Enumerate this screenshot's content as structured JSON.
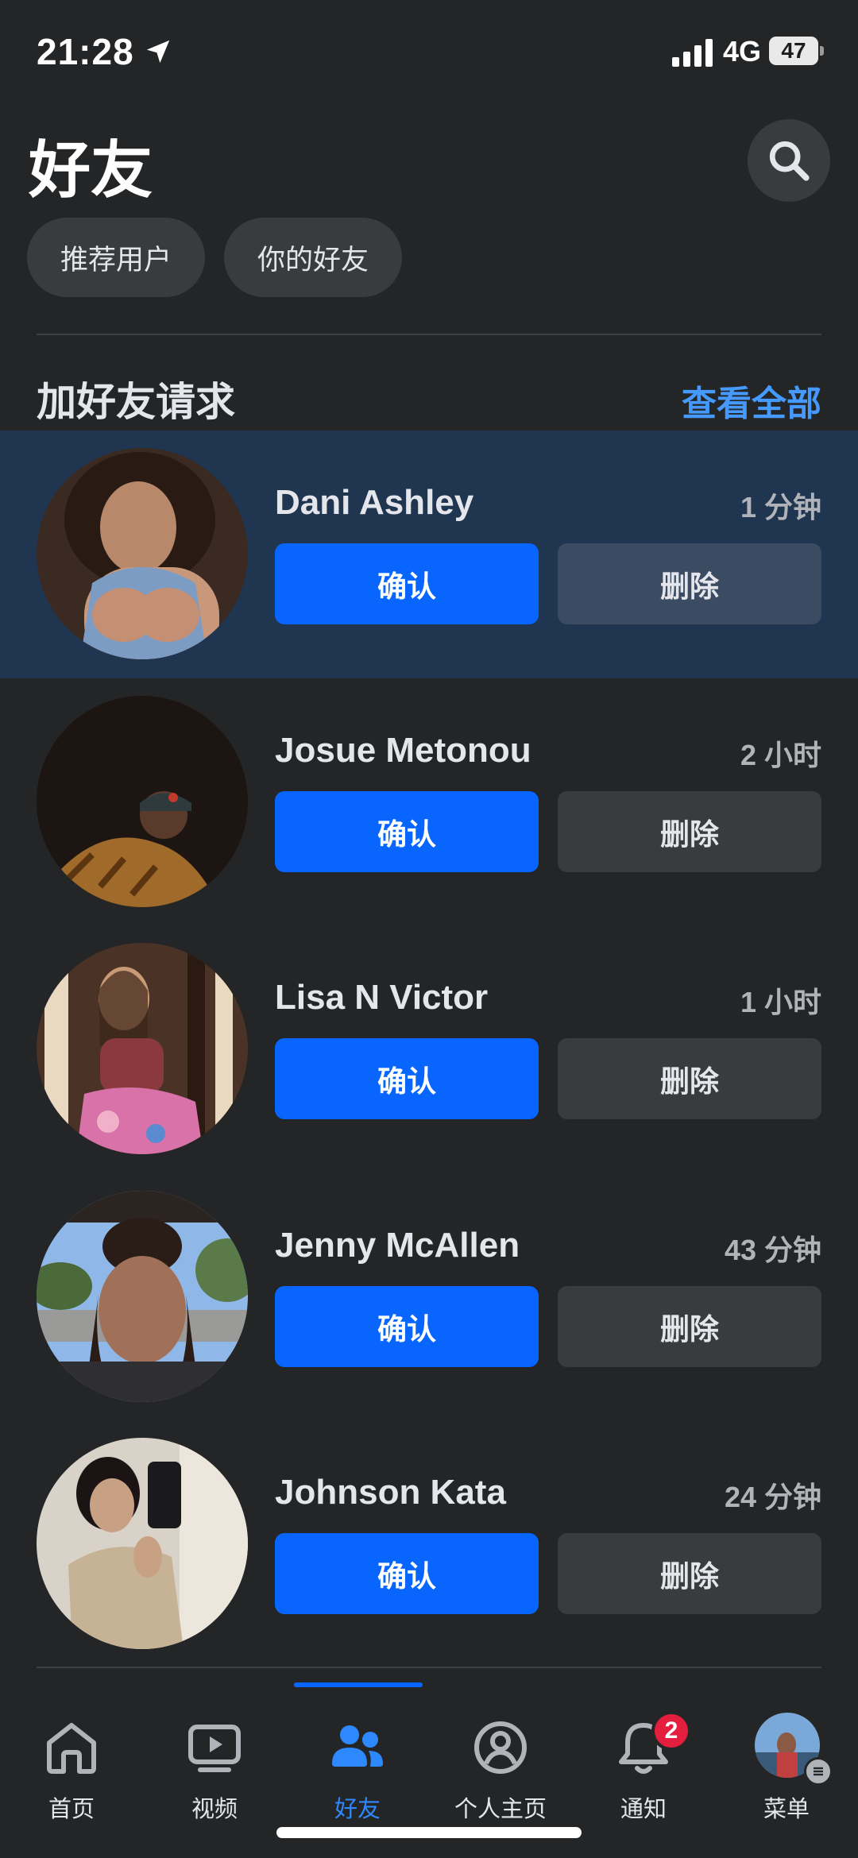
{
  "status_bar": {
    "time": "21:28",
    "network": "4G",
    "battery": "47"
  },
  "header": {
    "title": "好友",
    "chips": {
      "suggestions": "推荐用户",
      "your_friends": "你的好友"
    }
  },
  "requests_section": {
    "title": "加好友请求",
    "see_all": "查看全部",
    "items": [
      {
        "name": "Dani Ashley",
        "time": "1 分钟",
        "confirm": "确认",
        "delete": "删除"
      },
      {
        "name": "Josue Metonou",
        "time": "2 小时",
        "confirm": "确认",
        "delete": "删除"
      },
      {
        "name": "Lisa N Victor",
        "time": "1 小时",
        "confirm": "确认",
        "delete": "删除"
      },
      {
        "name": "Jenny McAllen",
        "time": "43 分钟",
        "confirm": "确认",
        "delete": "删除"
      },
      {
        "name": "Johnson Kata",
        "time": "24 分钟",
        "confirm": "确认",
        "delete": "删除"
      }
    ]
  },
  "tab_bar": {
    "tabs": [
      {
        "label": "首页",
        "icon": "home-icon"
      },
      {
        "label": "视频",
        "icon": "video-icon"
      },
      {
        "label": "好友",
        "icon": "friends-icon"
      },
      {
        "label": "个人主页",
        "icon": "profile-icon"
      },
      {
        "label": "通知",
        "icon": "bell-icon"
      },
      {
        "label": "菜单",
        "icon": "menu-avatar"
      }
    ],
    "notification_badge": "2"
  },
  "colors": {
    "background": "#242526",
    "accent": "#0866ff",
    "link": "#4599ff",
    "highlight_row": "#1f3550",
    "badge": "#e41e3f"
  }
}
